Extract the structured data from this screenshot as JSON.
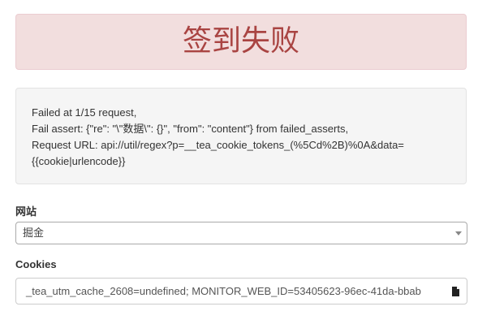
{
  "alert": {
    "title": "签到失败"
  },
  "error_details": {
    "line1": "Failed at 1/15 request,",
    "line2": "Fail assert: {\"re\": \"\\\"数据\\\": {}\", \"from\": \"content\"} from failed_asserts,",
    "line3": "Request URL: api://util/regex?p=__tea_cookie_tokens_(%5Cd%2B)%0A&data=",
    "line4": "{{cookie|urlencode}}"
  },
  "form": {
    "site_label": "网站",
    "site_selected": "掘金",
    "cookies_label": "Cookies",
    "cookies_value": "_tea_utm_cache_2608=undefined; MONITOR_WEB_ID=53405623-96ec-41da-bbab"
  },
  "icons": {
    "select_arrow": "chevron-down-icon",
    "cookies_field": "document-icon"
  },
  "colors": {
    "alert_background": "#f2dede",
    "alert_text": "#a94442",
    "well_background": "#f5f5f5"
  }
}
